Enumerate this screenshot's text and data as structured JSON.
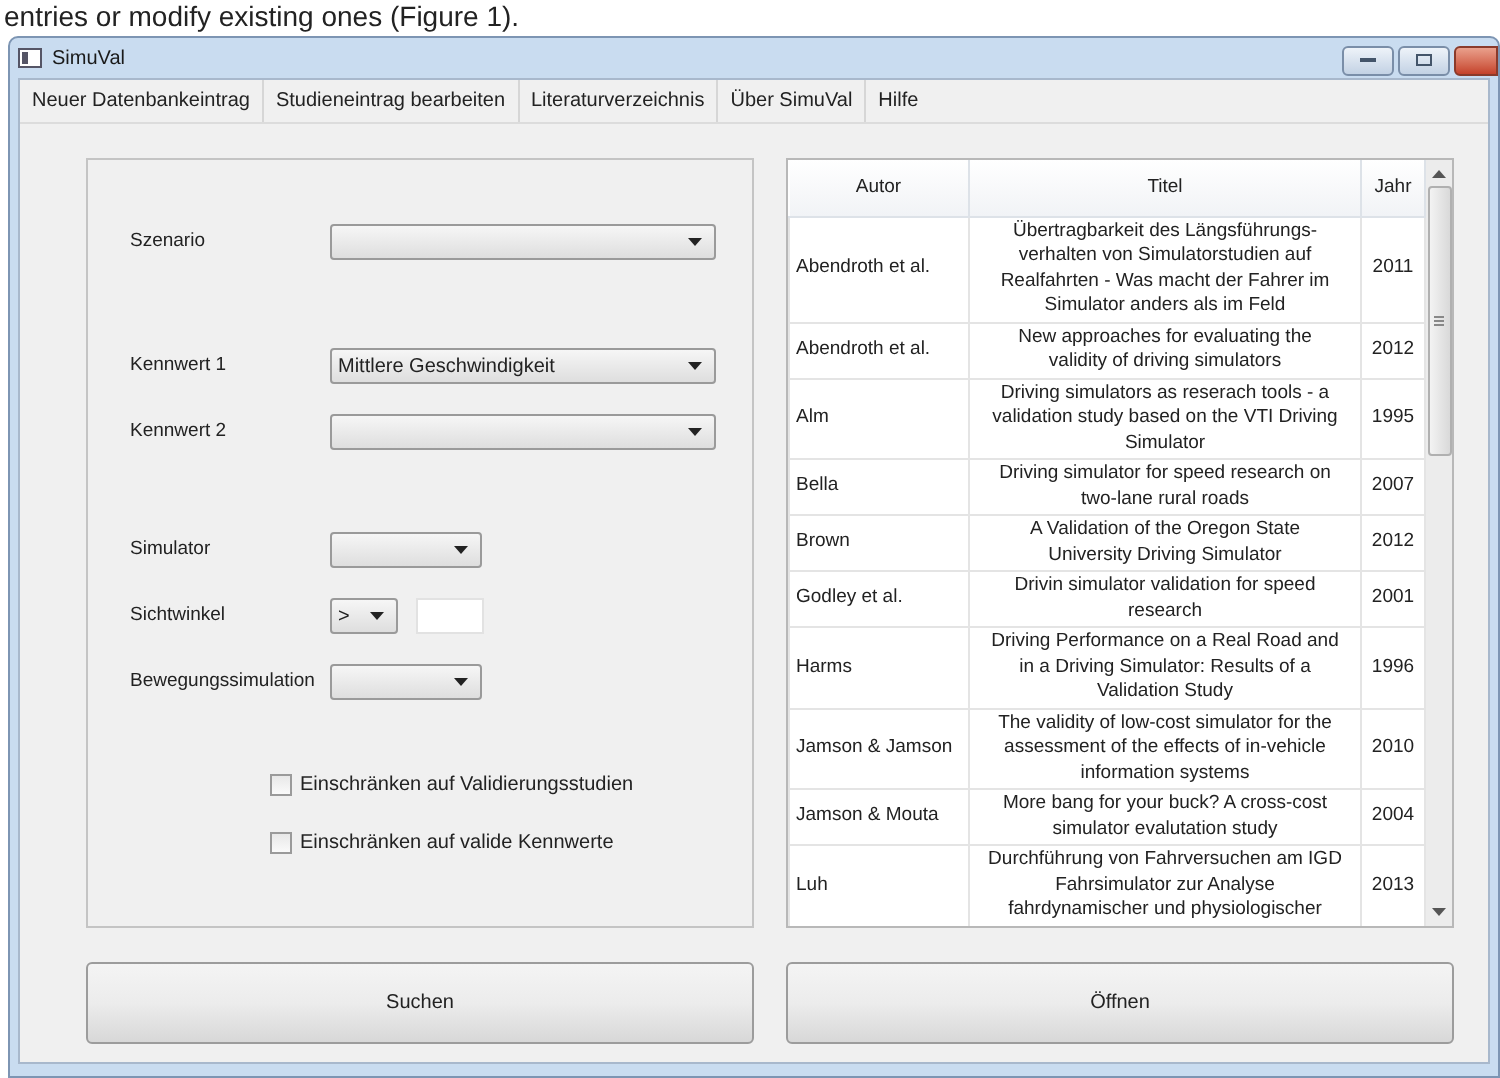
{
  "document_text": "entries or modify existing ones (Figure 1).",
  "window": {
    "title": "SimuVal"
  },
  "menu": [
    "Neuer Datenbankeintrag",
    "Studieneintrag bearbeiten",
    "Literaturverzeichnis",
    "Über SimuVal",
    "Hilfe"
  ],
  "form": {
    "groups": [
      [
        {
          "kind": "wide_combo",
          "label": "Szenario"
        }
      ],
      [
        {
          "kind": "wide_combo",
          "label": "Kennwert 1",
          "value": "Mittlere Geschwindigkeit"
        },
        {
          "kind": "wide_combo",
          "label": "Kennwert 2"
        }
      ],
      [
        {
          "kind": "narrow_combo",
          "label": "Simulator"
        },
        {
          "kind": "compare",
          "label": "Sichtwinkel",
          "value": ">"
        },
        {
          "kind": "narrow_combo",
          "label": "Bewegungssimulation"
        }
      ]
    ],
    "checkboxes": [
      {
        "label": "Einschränken auf Validierungsstudien",
        "checked": false
      },
      {
        "label": "Einschränken auf valide Kennwerte",
        "checked": false
      }
    ]
  },
  "search_button": "Suchen",
  "table": {
    "columns": [
      "Autor",
      "Titel",
      "Jahr"
    ],
    "rows": [
      {
        "author": "Abendroth et al.",
        "title_lines": [
          "Übertragbarkeit des Längsführungs-",
          "verhalten von Simulatorstudien auf",
          "Realfahrten - Was macht der Fahrer im",
          "Simulator anders als im Feld"
        ],
        "year": "2011"
      },
      {
        "author": "Abendroth et al.",
        "title_lines": [
          "New approaches for evaluating the",
          "validity of driving simulators"
        ],
        "year": "2012"
      },
      {
        "author": "Alm",
        "title_lines": [
          "Driving simulators as reserach tools - a",
          "validation study based on the VTI Driving",
          "Simulator"
        ],
        "year": "1995"
      },
      {
        "author": "Bella",
        "title_lines": [
          "Driving simulator for speed research on",
          "two-lane rural roads"
        ],
        "year": "2007"
      },
      {
        "author": "Brown",
        "title_lines": [
          "A Validation of the Oregon State",
          "University Driving Simulator"
        ],
        "year": "2012"
      },
      {
        "author": "Godley et al.",
        "title_lines": [
          "Drivin simulator validation for speed",
          "research"
        ],
        "year": "2001"
      },
      {
        "author": "Harms",
        "title_lines": [
          "Driving Performance on a Real Road and",
          "in a Driving Simulator: Results of a",
          "Validation Study"
        ],
        "year": "1996"
      },
      {
        "author": "Jamson & Jamson",
        "title_lines": [
          "The validity of low-cost simulator for the",
          "assessment of the effects of in-vehicle",
          "information systems"
        ],
        "year": "2010"
      },
      {
        "author": "Jamson & Mouta",
        "title_lines": [
          "More bang for your buck? A cross-cost",
          "simulator evalutation study"
        ],
        "year": "2004"
      },
      {
        "author": "Luh",
        "title_lines": [
          "Durchführung von Fahrversuchen am IGD",
          "Fahrsimulator zur Analyse",
          "fahrdynamischer und physiologischer"
        ],
        "year": "2013"
      }
    ]
  },
  "open_button": "Öffnen"
}
